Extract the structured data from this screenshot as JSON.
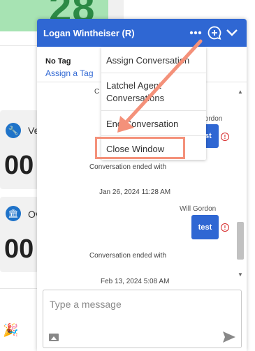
{
  "background": {
    "top_number": "28",
    "card1": {
      "label": "Ve",
      "value": "00",
      "icon": "wrench-icon"
    },
    "card2": {
      "label": "Ov",
      "value": "00",
      "icon": "bank-icon"
    },
    "party_icon": "🎉"
  },
  "chat": {
    "title": "Logan Wintheiser (R)",
    "header_icons": [
      "more-icon",
      "new-conversation-icon",
      "chevron-down-icon"
    ],
    "tag_label": "No Tag",
    "assign_tag": "Assign a Tag",
    "menu": [
      "Assign Conversation",
      "Latchel Agent Conversations",
      "End Conversation",
      "Close Window"
    ],
    "partial_c": "C",
    "partial_sender": "Gordon",
    "partial_bubble": "test",
    "system_message_1": "Conversation ended with",
    "timestamp_1": "Jan 26, 2024 11:28 AM",
    "sender": "Will Gordon",
    "bubble_text": "test",
    "error_icon": "!",
    "system_message_2": "Conversation ended with",
    "timestamp_2": "Feb 13, 2024 5:08 AM",
    "input_placeholder": "Type a message",
    "accent_color": "#2f67d3",
    "annotation_color": "#f4917a"
  }
}
